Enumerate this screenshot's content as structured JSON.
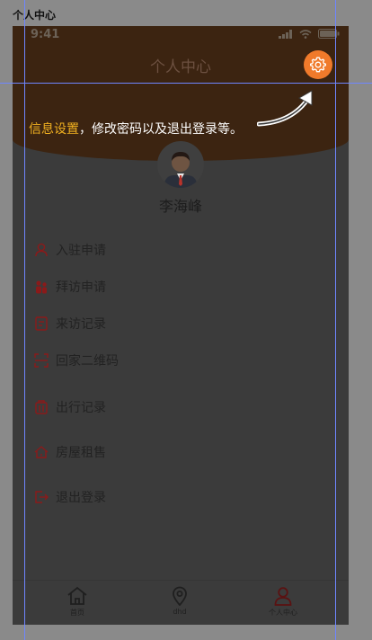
{
  "page": {
    "label": "个人中心"
  },
  "status_bar": {
    "time": "9:41"
  },
  "header": {
    "title": "个人中心"
  },
  "settings": {
    "icon": "gear-icon",
    "color": "#f07a2b"
  },
  "profile": {
    "name": "李海峰"
  },
  "menu": [
    {
      "label": "入驻申请",
      "icon": "person-icon"
    },
    {
      "label": "拜访申请",
      "icon": "visitors-icon"
    },
    {
      "label": "来访记录",
      "icon": "record-icon"
    },
    {
      "label": "回家二维码",
      "icon": "qrcode-icon"
    },
    {
      "label": "出行记录",
      "icon": "travel-icon"
    },
    {
      "label": "房屋租售",
      "icon": "house-icon"
    },
    {
      "label": "退出登录",
      "icon": "logout-icon"
    }
  ],
  "tabbar": [
    {
      "label": "首页",
      "icon": "home-icon"
    },
    {
      "label": "dhd",
      "icon": "location-icon"
    },
    {
      "label": "个人中心",
      "icon": "user-icon"
    }
  ],
  "tooltip": {
    "highlight": "信息设置",
    "text": "，修改密码以及退出登录等。"
  },
  "colors": {
    "accent": "#f07a2b",
    "highlight": "#f0b020",
    "menu_icon": "#8a1a1a"
  }
}
